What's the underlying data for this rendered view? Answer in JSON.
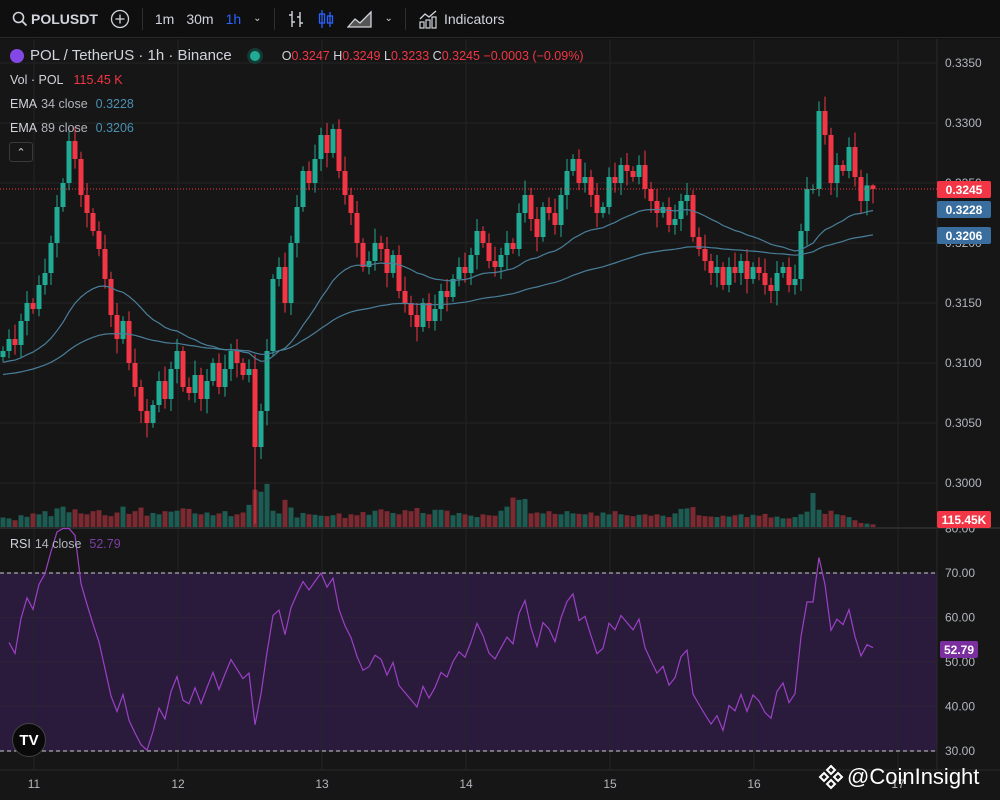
{
  "toolbar": {
    "symbol": "POLUSDT",
    "intervals": [
      "1m",
      "30m",
      "1h"
    ],
    "active_interval": "1h",
    "indicators_label": "Indicators"
  },
  "legend": {
    "title": "POL / TetherUS · 1h · Binance",
    "o_label": "O",
    "o": "0.3247",
    "h_label": "H",
    "h": "0.3249",
    "l_label": "L",
    "l": "0.3233",
    "c_label": "C",
    "c": "0.3245",
    "change": "−0.0003 (−0.09%)",
    "vol_label": "Vol · POL",
    "vol_value": "115.45 K",
    "ema34_label": "EMA",
    "ema34_params": "34 close",
    "ema34_value": "0.3228",
    "ema89_label": "EMA",
    "ema89_params": "89 close",
    "ema89_value": "0.3206",
    "rsi_label": "RSI",
    "rsi_params": "14 close",
    "rsi_value": "52.79"
  },
  "badges": {
    "last_price": "0.3245",
    "ema34": "0.3228",
    "ema89": "0.3206",
    "volume": "115.45K",
    "rsi": "52.79"
  },
  "watermark": "@CoinInsight",
  "colors": {
    "up": "#22ab94",
    "down": "#f23645",
    "ema": "#4a7f9a",
    "ema_badge": "#3a6e9f",
    "rsi": "#9c40c4",
    "rsi_band": "#2a1b3d",
    "background": "#161616"
  },
  "chart_data": {
    "type": "candlestick",
    "title": "POL / TetherUS · 1h · Binance",
    "x_ticks": [
      "11",
      "12",
      "13",
      "14",
      "15",
      "16",
      "17"
    ],
    "price_ticks": [
      "0.3350",
      "0.3300",
      "0.3250",
      "0.3200",
      "0.3150",
      "0.3100",
      "0.3050",
      "0.3000"
    ],
    "ylim": [
      0.2965,
      0.3365
    ],
    "last_candle": {
      "open": 0.3247,
      "high": 0.3249,
      "low": 0.3233,
      "close": 0.3245
    },
    "closes": [
      0.311,
      0.312,
      0.3115,
      0.3135,
      0.315,
      0.3145,
      0.3165,
      0.3175,
      0.32,
      0.323,
      0.325,
      0.3285,
      0.327,
      0.324,
      0.3225,
      0.321,
      0.3195,
      0.317,
      0.314,
      0.312,
      0.3135,
      0.31,
      0.308,
      0.306,
      0.305,
      0.3065,
      0.3085,
      0.307,
      0.3095,
      0.311,
      0.308,
      0.3075,
      0.309,
      0.307,
      0.3085,
      0.31,
      0.308,
      0.3095,
      0.311,
      0.31,
      0.309,
      0.3095,
      0.303,
      0.306,
      0.311,
      0.317,
      0.318,
      0.315,
      0.32,
      0.323,
      0.326,
      0.325,
      0.327,
      0.329,
      0.3275,
      0.3295,
      0.326,
      0.324,
      0.3225,
      0.32,
      0.318,
      0.3185,
      0.32,
      0.3195,
      0.3175,
      0.319,
      0.316,
      0.315,
      0.314,
      0.313,
      0.315,
      0.3135,
      0.3145,
      0.316,
      0.3155,
      0.317,
      0.318,
      0.3175,
      0.319,
      0.321,
      0.32,
      0.3185,
      0.318,
      0.319,
      0.32,
      0.3195,
      0.3225,
      0.324,
      0.322,
      0.3205,
      0.323,
      0.3225,
      0.3215,
      0.324,
      0.326,
      0.327,
      0.325,
      0.3255,
      0.324,
      0.3225,
      0.323,
      0.3255,
      0.325,
      0.3265,
      0.326,
      0.3255,
      0.3265,
      0.3245,
      0.3235,
      0.3225,
      0.323,
      0.3215,
      0.322,
      0.3235,
      0.324,
      0.3205,
      0.3195,
      0.3185,
      0.3175,
      0.318,
      0.3165,
      0.318,
      0.3175,
      0.3185,
      0.317,
      0.318,
      0.3175,
      0.3165,
      0.316,
      0.3175,
      0.318,
      0.3165,
      0.317,
      0.321,
      0.3245,
      0.3245,
      0.331,
      0.329,
      0.325,
      0.3265,
      0.326,
      0.328,
      0.3255,
      0.3235,
      0.3248,
      0.3245
    ],
    "volumes_k": [
      420,
      380,
      300,
      520,
      450,
      600,
      560,
      700,
      480,
      820,
      900,
      650,
      780,
      600,
      560,
      700,
      740,
      520,
      480,
      640,
      900,
      580,
      700,
      860,
      500,
      620,
      560,
      700,
      680,
      720,
      820,
      800,
      600,
      560,
      640,
      520,
      600,
      700,
      480,
      560,
      640,
      980,
      1650,
      1560,
      1900,
      720,
      600,
      1200,
      860,
      420,
      620,
      560,
      540,
      500,
      480,
      520,
      600,
      400,
      560,
      520,
      660,
      540,
      720,
      780,
      700,
      620,
      560,
      740,
      700,
      840,
      620,
      560,
      760,
      760,
      720,
      520,
      620,
      560,
      500,
      440,
      560,
      520,
      500,
      720,
      900,
      1300,
      1200,
      1240,
      600,
      640,
      600,
      700,
      580,
      560,
      700,
      600,
      580,
      560,
      640,
      500,
      640,
      560,
      700,
      560,
      520,
      480,
      540,
      560,
      500,
      560,
      500,
      440,
      600,
      800,
      820,
      880,
      520,
      480,
      460,
      440,
      500,
      460,
      520,
      560,
      440,
      540,
      500,
      580,
      420,
      460,
      380,
      380,
      440,
      560,
      680,
      1500,
      760,
      580,
      720,
      560,
      520,
      440,
      300,
      180,
      150,
      115.45
    ],
    "rsi": {
      "period": 14,
      "ticks": [
        "80.00",
        "70.00",
        "60.00",
        "50.00",
        "40.00",
        "30.00"
      ],
      "ylim": [
        30,
        80
      ],
      "bands": [
        30,
        70
      ]
    },
    "ema_periods": [
      34,
      89
    ]
  }
}
